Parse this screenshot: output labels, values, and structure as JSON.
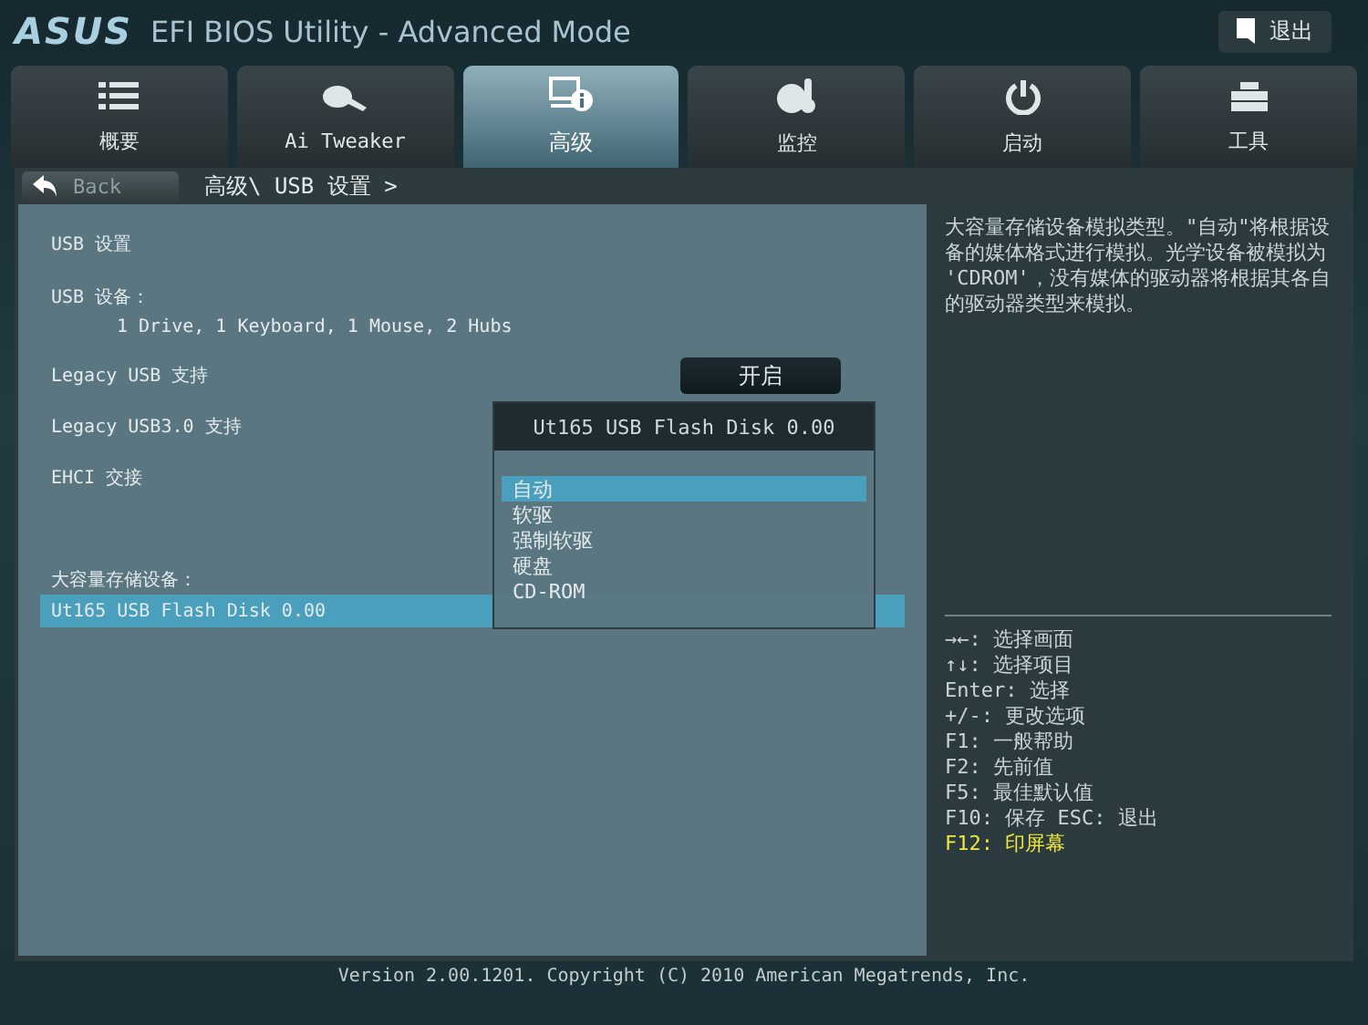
{
  "header": {
    "brand": "ASUS",
    "title": "EFI BIOS Utility - Advanced Mode",
    "exit": "退出"
  },
  "tabs": [
    {
      "label": "概要",
      "selected": false
    },
    {
      "label": "Ai Tweaker",
      "selected": false
    },
    {
      "label": "高级",
      "selected": true
    },
    {
      "label": "监控",
      "selected": false
    },
    {
      "label": "启动",
      "selected": false
    },
    {
      "label": "工具",
      "selected": false
    }
  ],
  "back_button": "Back",
  "breadcrumb": "高级\\ USB 设置 >",
  "settings": [
    {
      "kind": "heading",
      "label": "USB 设置"
    },
    {
      "kind": "info",
      "label": "USB 设备：",
      "detail": "1 Drive, 1 Keyboard, 1 Mouse, 2 Hubs"
    },
    {
      "kind": "option",
      "label": "Legacy USB 支持",
      "value": "开启"
    },
    {
      "kind": "option",
      "label": "Legacy USB3.0 支持"
    },
    {
      "kind": "option",
      "label": "EHCI 交接"
    },
    {
      "kind": "section",
      "label": "大容量存储设备："
    },
    {
      "kind": "device",
      "label": "Ut165 USB Flash Disk 0.00",
      "selected": true
    }
  ],
  "popup": {
    "title": "Ut165 USB Flash Disk 0.00",
    "options": [
      {
        "label": "自动",
        "selected": true
      },
      {
        "label": "软驱",
        "selected": false
      },
      {
        "label": "强制软驱",
        "selected": false
      },
      {
        "label": "硬盘",
        "selected": false
      },
      {
        "label": "CD-ROM",
        "selected": false
      }
    ]
  },
  "help_text": "大容量存储设备模拟类型。\"自动\"将根据设备的媒体格式进行模拟。光学设备被模拟为\n'CDROM'，没有媒体的驱动器将根据其各自的驱动器类型来模拟。",
  "key_hints": [
    {
      "text": "→←: 选择画面",
      "highlight": false
    },
    {
      "text": "↑↓: 选择项目",
      "highlight": false
    },
    {
      "text": "Enter: 选择",
      "highlight": false
    },
    {
      "text": "+/-: 更改选项",
      "highlight": false
    },
    {
      "text": "F1: 一般帮助",
      "highlight": false
    },
    {
      "text": "F2: 先前值",
      "highlight": false
    },
    {
      "text": "F5: 最佳默认值",
      "highlight": false
    },
    {
      "text": "F10: 保存  ESC: 退出",
      "highlight": false
    },
    {
      "text": "F12: 印屏幕",
      "highlight": true
    }
  ],
  "footer": "Version 2.00.1201. Copyright (C) 2010 American Megatrends, Inc."
}
